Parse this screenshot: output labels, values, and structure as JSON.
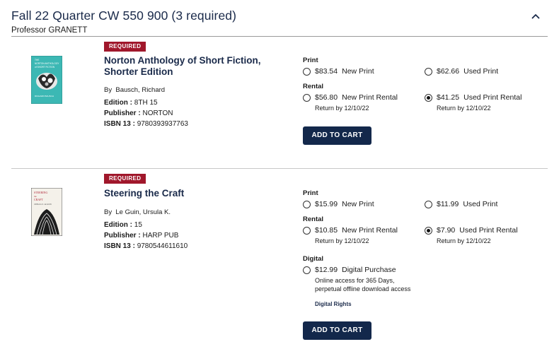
{
  "course": {
    "title": "Fall 22 Quarter CW 550 900 (3 required)",
    "professor": "Professor GRANETT",
    "collapse_icon": "chevron-up-icon"
  },
  "books": [
    {
      "badge": "REQUIRED",
      "title": "Norton Anthology of Short Fiction, Shorter Edition",
      "author_prefix": "By",
      "author": "Bausch, Richard",
      "edition_label": "Edition :",
      "edition": "8TH 15",
      "publisher_label": "Publisher :",
      "publisher": "NORTON",
      "isbn_label": "ISBN 13 :",
      "isbn": "9780393937763",
      "cover_text": [
        "THE",
        "NORTON ANTHOLOGY",
        "of SHORT FICTION",
        "RICHARD BAUSCH"
      ],
      "print_label": "Print",
      "rental_label": "Rental",
      "options": {
        "new_print": {
          "price": "$83.54",
          "label": "New Print",
          "checked": false
        },
        "used_print": {
          "price": "$62.66",
          "label": "Used Print",
          "checked": false
        },
        "new_rental": {
          "price": "$56.80",
          "label": "New Print Rental",
          "note": "Return by 12/10/22",
          "checked": false
        },
        "used_rental": {
          "price": "$41.25",
          "label": "Used Print Rental",
          "note": "Return by 12/10/22",
          "checked": true
        }
      },
      "add_to_cart": "ADD TO CART"
    },
    {
      "badge": "REQUIRED",
      "title": "Steering the Craft",
      "author_prefix": "By",
      "author": "Le Guin, Ursula K.",
      "edition_label": "Edition :",
      "edition": "15",
      "publisher_label": "Publisher :",
      "publisher": "HARP PUB",
      "isbn_label": "ISBN 13 :",
      "isbn": "9780544611610",
      "cover_text": [
        "STEERING",
        "the",
        "CRAFT",
        "URSULA K. LE GUIN"
      ],
      "print_label": "Print",
      "rental_label": "Rental",
      "digital_label": "Digital",
      "options": {
        "new_print": {
          "price": "$15.99",
          "label": "New Print",
          "checked": false
        },
        "used_print": {
          "price": "$11.99",
          "label": "Used Print",
          "checked": false
        },
        "new_rental": {
          "price": "$10.85",
          "label": "New Print Rental",
          "note": "Return by 12/10/22",
          "checked": false
        },
        "used_rental": {
          "price": "$7.90",
          "label": "Used Print Rental",
          "note": "Return by 12/10/22",
          "checked": true
        },
        "digital": {
          "price": "$12.99",
          "label": "Digital Purchase",
          "note_line1": "Online access for 365 Days,",
          "note_line2": "perpetual offline download access",
          "checked": false
        }
      },
      "digital_rights": "Digital Rights",
      "add_to_cart": "ADD TO CART"
    }
  ]
}
